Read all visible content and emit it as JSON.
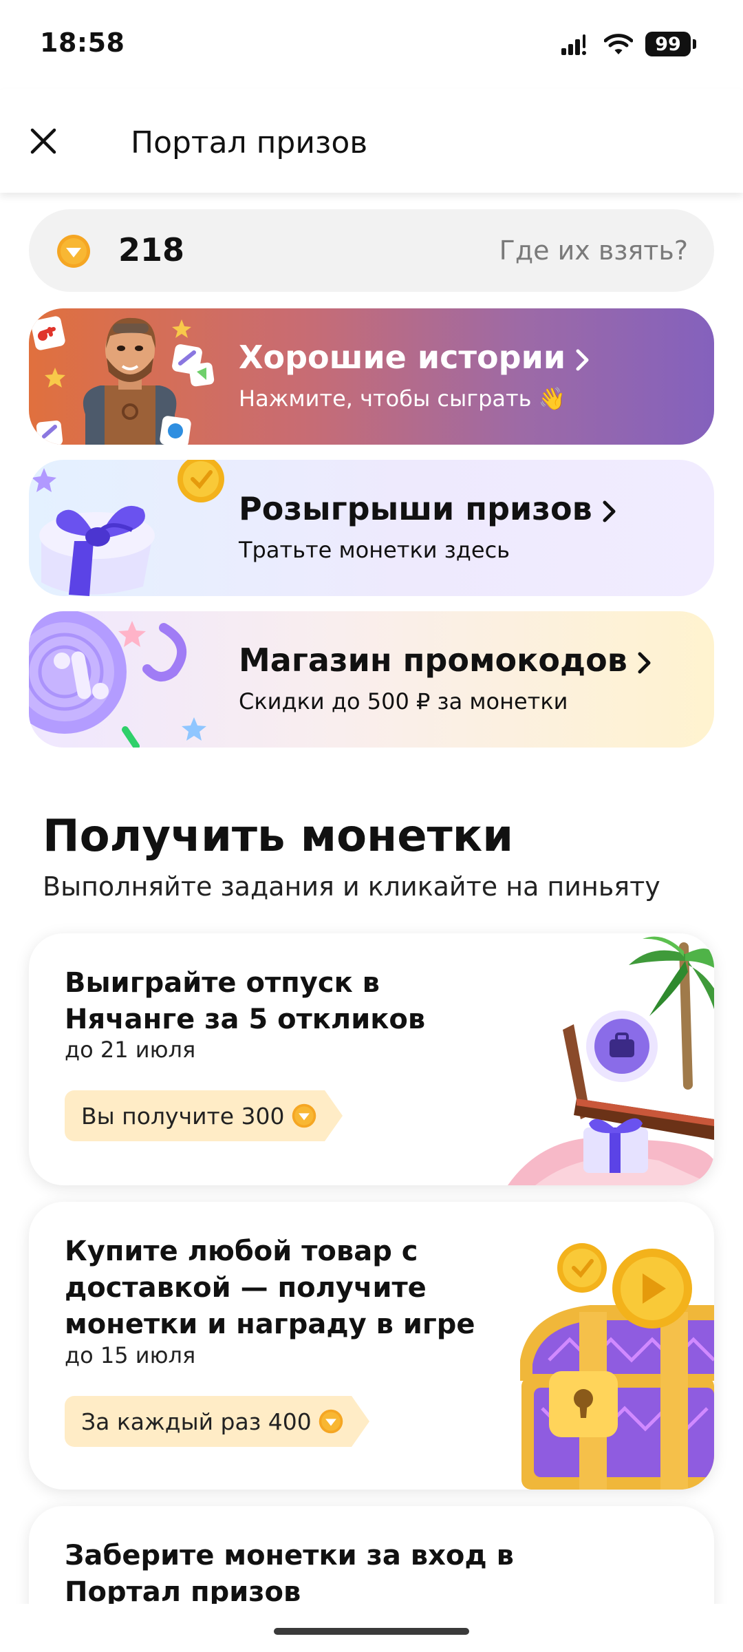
{
  "status": {
    "time": "18:58",
    "battery": "99"
  },
  "header": {
    "title": "Портал призов"
  },
  "balance": {
    "value": "218",
    "help": "Где их взять?"
  },
  "promos": [
    {
      "title": "Хорошие истории",
      "subtitle": "Нажмите, чтобы сыграть 👋"
    },
    {
      "title": "Розыгрыши призов",
      "subtitle": "Тратьте монетки здесь"
    },
    {
      "title": "Магазин промокодов",
      "subtitle": "Скидки до 500 ₽ за монетки"
    }
  ],
  "section": {
    "title": "Получить монетки",
    "subtitle": "Выполняйте задания и кликайте на пиньяту"
  },
  "tasks": [
    {
      "title": "Выиграйте отпуск в Нячанге за 5 откликов",
      "date": "до 21 июля",
      "reward": "Вы получите 300"
    },
    {
      "title": "Купите любой товар с доставкой — получите монетки и награду в игре",
      "date": "до 15 июля",
      "reward": "За каждый раз 400"
    },
    {
      "title": "Заберите монетки за вход в Портал призов"
    }
  ],
  "colors": {
    "coin": "#f5a623",
    "accent_purple": "#8461bd",
    "accent_orange": "#e0703e",
    "reward_bg": "#ffecc6"
  },
  "icons": {
    "close": "close-icon",
    "coin": "coin-icon",
    "chevron": "chevron-right-icon"
  }
}
